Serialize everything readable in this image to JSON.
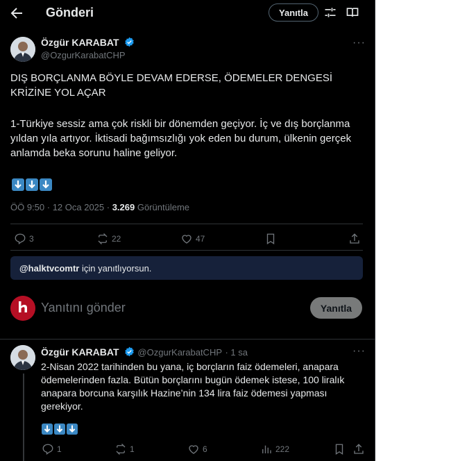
{
  "header": {
    "title": "Gönderi",
    "reply_button": "Yanıtla"
  },
  "main_post": {
    "author_name": "Özgür KARABAT",
    "author_handle": "@OzgurKarabatCHP",
    "headline": "DIŞ BORÇLANMA BÖYLE DEVAM EDERSE, ÖDEMELER DENGESİ KRİZİNE YOL AÇAR",
    "body": "1-Türkiye sessiz ama çok riskli bir dönemden geçiyor. İç ve dış borçlanma yıldan yıla artıyor. İktisadi bağımsızlığı yok eden bu durum, ülkenin gerçek anlamda beka sorunu haline geliyor.",
    "emojis": [
      "⬇️",
      "⬇️",
      "⬇️"
    ],
    "timestamp": "ÖÖ 9:50 · 12 Oca 2025 · ",
    "views": "3.269",
    "views_label": " Görüntüleme",
    "replies": "3",
    "reposts": "22",
    "likes": "47"
  },
  "composer": {
    "replying_to": "@halktvcomtr",
    "replying_suffix": " için yanıtlıyorsun.",
    "placeholder": "Yanıtını gönder",
    "reply_button": "Yanıtla",
    "avatar_letter": "h",
    "avatar_sub": "halktv"
  },
  "reply_post": {
    "author_name": "Özgür KARABAT",
    "author_handle": "@OzgurKarabatCHP",
    "time": "· 1 sa",
    "body": "2-Nisan 2022 tarihinden bu yana, iç borçların faiz ödemeleri, anapara ödemelerinden fazla. Bütün borçlarını bugün ödemek istese, 100 liralık anapara borcuna karşılık Hazine’nin 134 lira faiz ödemesi yapması gerekiyor.",
    "emojis": [
      "⬇️",
      "⬇️",
      "⬇️"
    ],
    "replies": "1",
    "reposts": "1",
    "likes": "6",
    "views": "222"
  },
  "colors": {
    "background": "#000000",
    "text": "#e7e9ea",
    "muted": "#71767b",
    "verified": "#1d9bf0",
    "emoji_blue": "#3b88c3",
    "replying_bg": "#16213a",
    "halktv_red": "#c8102e"
  },
  "icons": [
    "back-arrow-icon",
    "settings-sliders-icon",
    "reader-icon",
    "verified-badge-icon",
    "more-icon",
    "reply-icon",
    "repost-icon",
    "like-icon",
    "bookmark-icon",
    "share-icon",
    "views-icon",
    "arrow-down-emoji"
  ]
}
